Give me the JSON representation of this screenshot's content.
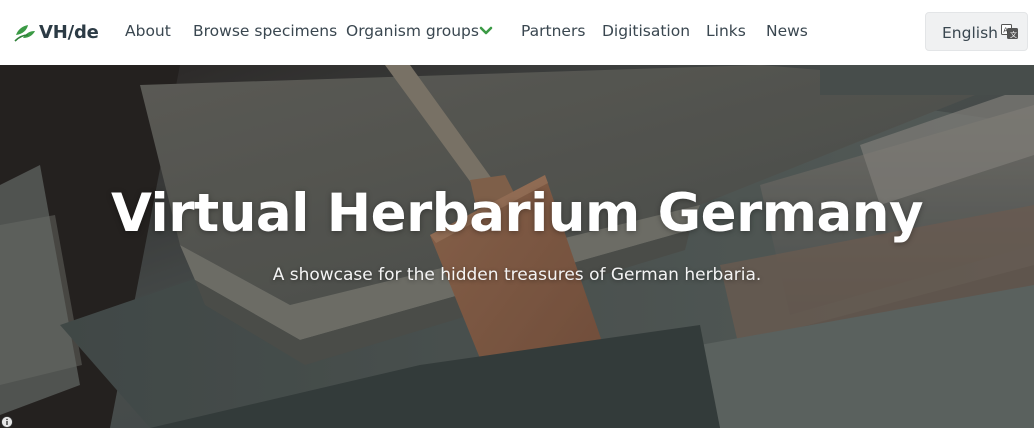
{
  "brand": {
    "name": "VH/de",
    "icon": "leaf-logo-icon",
    "color": "#3b9a45"
  },
  "nav": {
    "items": [
      {
        "label": "About"
      },
      {
        "label": "Browse specimens"
      },
      {
        "label": "Organism groups",
        "has_dropdown": true
      },
      {
        "label": "Partners"
      },
      {
        "label": "Digitisation"
      },
      {
        "label": "Links"
      },
      {
        "label": "News"
      }
    ],
    "dropdown_icon": "chevron-down-icon",
    "accent_color": "#3b9a45"
  },
  "language": {
    "label": "English",
    "icon": "translate-icon"
  },
  "hero": {
    "title": "Virtual Herbarium Germany",
    "subtitle": "A showcase for the hidden treasures of German herbaria.",
    "background": "herbarium-folders-photo",
    "info_icon": "info-icon"
  }
}
